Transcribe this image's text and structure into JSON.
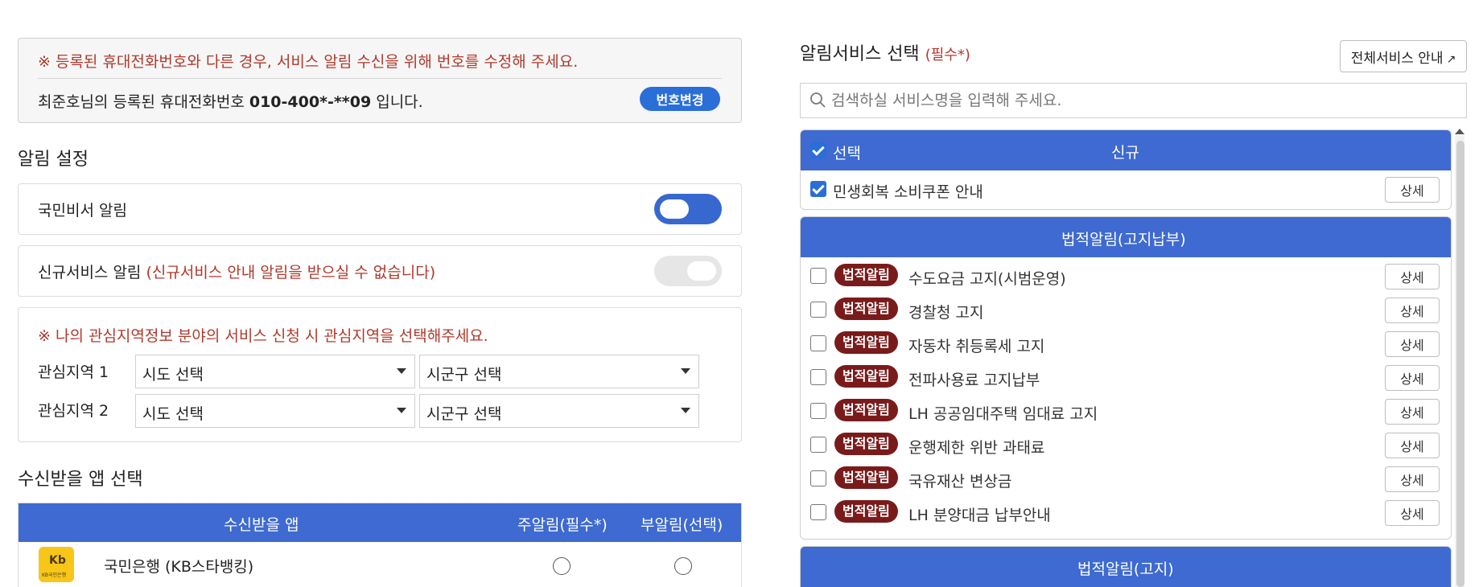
{
  "phone": {
    "warning": "※ 등록된 휴대전화번호와 다른 경우, 서비스 알림 수신을 위해 번호를 수정해 주세요.",
    "prefix": "최준호님의 등록된 휴대전화번호 ",
    "number": "010-400*-**09",
    "suffix": " 입니다.",
    "change_button": "번호변경"
  },
  "alarm_settings": {
    "title": "알림 설정",
    "secretary_alarm": {
      "label": "국민비서 알림",
      "enabled": true
    },
    "new_service_alarm": {
      "label": "신규서비스 알림 ",
      "note": "(신규서비스 안내 알림을 받으실 수 없습니다)",
      "enabled": false
    }
  },
  "region": {
    "warning": "※ 나의 관심지역정보 분야의 서비스 신청 시 관심지역을 선택해주세요.",
    "rows": [
      {
        "label": "관심지역 1",
        "sido": "시도 선택",
        "sigungu": "시군구 선택"
      },
      {
        "label": "관심지역 2",
        "sido": "시도 선택",
        "sigungu": "시군구 선택"
      }
    ]
  },
  "app_select": {
    "title": "수신받을 앱 선택",
    "columns": [
      "수신받을 앱",
      "주알림(필수*)",
      "부알림(선택)"
    ],
    "apps": [
      {
        "name": "국민은행 (KB스타뱅킹)",
        "logo_mark": "Kb",
        "logo_sub": "KB국민은행",
        "logo_color": "#f7c619",
        "primary_selected": false,
        "secondary_selected": false
      }
    ]
  },
  "services": {
    "title": "알림서비스 선택",
    "required": "(필수*)",
    "all_button": "전체서비스 안내",
    "search_placeholder": "검색하실 서비스명을 입력해 주세요.",
    "select_all_label": "선택",
    "detail_label": "상세",
    "badge_label": "법적알림",
    "groups": [
      {
        "title": "신규",
        "items": [
          {
            "name": "민생회복 소비쿠폰 안내",
            "checked": true
          }
        ]
      },
      {
        "title": "법적알림(고지납부)",
        "items": [
          {
            "name": "수도요금 고지(시범운영)",
            "checked": false
          },
          {
            "name": "경찰청 고지",
            "checked": false
          },
          {
            "name": "자동차 취등록세 고지",
            "checked": false
          },
          {
            "name": "전파사용료 고지납부",
            "checked": false
          },
          {
            "name": "LH 공공임대주택 임대료 고지",
            "checked": false
          },
          {
            "name": "운행제한 위반 과태료",
            "checked": false
          },
          {
            "name": "국유재산 변상금",
            "checked": false
          },
          {
            "name": "LH 분양대금 납부안내",
            "checked": false
          }
        ]
      },
      {
        "title": "법적알림(고지)",
        "items": []
      }
    ]
  },
  "colors": {
    "accent_blue": "#3e6ad1",
    "warning_red": "#b0392b",
    "badge_maroon": "#7a1b1b"
  }
}
